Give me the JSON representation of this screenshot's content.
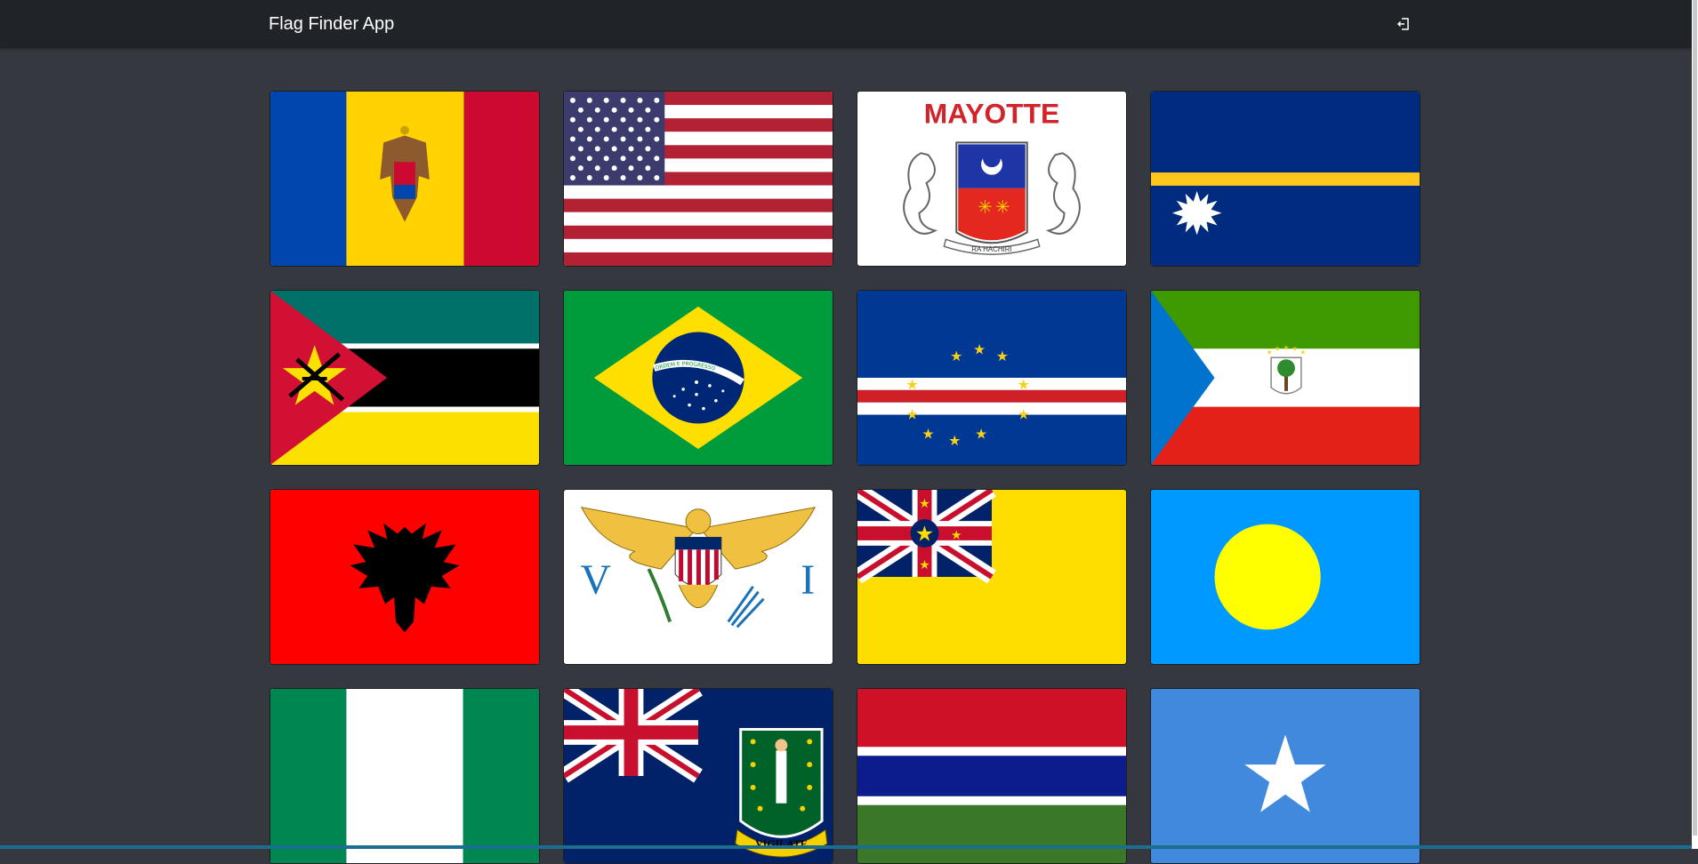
{
  "app": {
    "title": "Flag Finder App",
    "logout_icon": "logout-icon"
  },
  "flags": [
    {
      "icon": "flag-moldova"
    },
    {
      "icon": "flag-united-states"
    },
    {
      "icon": "flag-mayotte",
      "text": "MAYOTTE",
      "motto": "RA HACHIRI"
    },
    {
      "icon": "flag-nauru"
    },
    {
      "icon": "flag-mozambique"
    },
    {
      "icon": "flag-brazil",
      "motto": "ORDEM E PROGRESSO"
    },
    {
      "icon": "flag-cape-verde"
    },
    {
      "icon": "flag-equatorial-guinea"
    },
    {
      "icon": "flag-albania"
    },
    {
      "icon": "flag-us-virgin-islands",
      "left_letter": "V",
      "right_letter": "I"
    },
    {
      "icon": "flag-niue"
    },
    {
      "icon": "flag-palau"
    },
    {
      "icon": "flag-nigeria"
    },
    {
      "icon": "flag-british-virgin-islands",
      "motto": "VIGILATE"
    },
    {
      "icon": "flag-gambia"
    },
    {
      "icon": "flag-somalia"
    }
  ],
  "colors": {
    "background": "#35383e",
    "topbar": "#202327"
  }
}
